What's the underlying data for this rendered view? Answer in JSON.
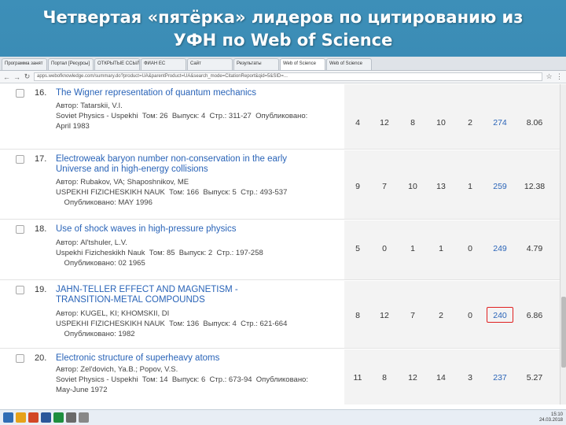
{
  "slide": {
    "title_line1": "Четвертая «пятёрка» лидеров по цитированию из",
    "title_line2": "УФН по Web of Science"
  },
  "browser": {
    "tabs": [
      "Программа занят",
      "Портал [Ресурсы]",
      "ОТКРЫТЫЕ ССЫЛ",
      "ФИАН ЕС",
      "Сайт",
      "Результаты",
      "Web of Science",
      "Web of Science"
    ],
    "address": "apps.webofknowledge.com/summary.do?product=UA&parentProduct=UA&search_mode=CitationReport&qid=5&SID=..."
  },
  "records": [
    {
      "num": "16.",
      "title": "The Wigner representation of quantum mechanics",
      "meta": [
        "Автор: Tatarskii, V.I.",
        "Soviet Physics - Uspekhi  Том: 26  Выпуск: 4  Стр.: 311-27  Опубликовано:",
        "April 1983"
      ],
      "years": [
        "4",
        "12",
        "8",
        "10",
        "2"
      ],
      "total": "274",
      "avg": "8.06"
    },
    {
      "num": "17.",
      "title": "Electroweak baryon number non-conservation in the early Universe and in high-energy collisions",
      "meta": [
        "Автор: Rubakov, VA; Shaposhnikov, ME",
        "USPEKHI FIZICHESKIKH NAUK  Том: 166  Выпуск: 5  Стр.: 493-537",
        "    Опубликовано: MAY 1996"
      ],
      "years": [
        "9",
        "7",
        "10",
        "13",
        "1"
      ],
      "total": "259",
      "avg": "12.38"
    },
    {
      "num": "18.",
      "title": "Use of shock waves in high-pressure physics",
      "meta": [
        "Автор: Al'tshuler, L.V.",
        "Uspekhi Fizicheskikh Nauk  Том: 85  Выпуск: 2  Стр.: 197-258",
        "    Опубликовано: 02 1965"
      ],
      "years": [
        "5",
        "0",
        "1",
        "1",
        "0"
      ],
      "total": "249",
      "avg": "4.79"
    },
    {
      "num": "19.",
      "title": "JAHN-TELLER EFFECT AND MAGNETISM - TRANSITION-METAL COMPOUNDS",
      "meta": [
        "Автор: KUGEL, KI; KHOMSKII, DI",
        "USPEKHI FIZICHESKIKH NAUK  Том: 136  Выпуск: 4  Стр.: 621-664",
        "    Опубликовано: 1982"
      ],
      "years": [
        "8",
        "12",
        "7",
        "2",
        "0"
      ],
      "total": "240",
      "avg": "6.86"
    },
    {
      "num": "20.",
      "title": "Electronic structure of superheavy atoms",
      "meta": [
        "Автор: Zel'dovich, Ya.B.; Popov, V.S.",
        "Soviet Physics - Uspekhi  Том: 14  Выпуск: 6  Стр.: 673-94  Опубликовано:",
        "May-June 1972"
      ],
      "years": [
        "11",
        "8",
        "12",
        "14",
        "3"
      ],
      "total": "237",
      "avg": "5.27"
    }
  ],
  "taskbar": {
    "time": "15:10",
    "date": "24.03.2018"
  },
  "colors": {
    "link": "#2a64b8",
    "highlight": "#e02020",
    "slide_bg": "#2c7aa6"
  }
}
